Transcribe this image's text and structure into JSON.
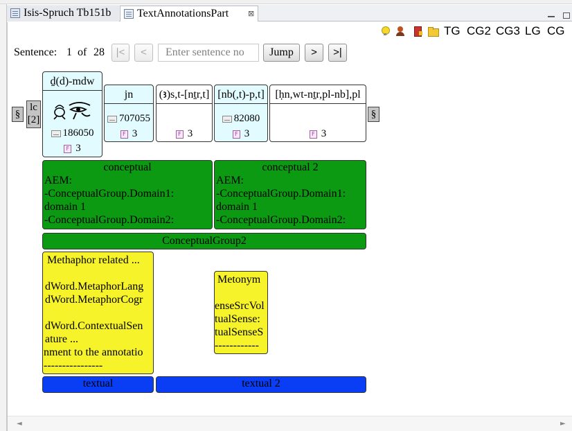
{
  "tabs": [
    {
      "label": "Isis-Spruch Tb151b",
      "icon": "document-icon",
      "active": false
    },
    {
      "label": "TextAnnotationsPart",
      "icon": "document-icon",
      "active": true,
      "close_glyph": "⊠"
    }
  ],
  "toolbar": {
    "icons": [
      "lightbulb-icon",
      "person-icon",
      "book-icon",
      "folder-icon"
    ],
    "links": [
      "TG",
      "CG2",
      "CG3",
      "LG",
      "CG"
    ]
  },
  "nav": {
    "label": "Sentence:",
    "current": "1",
    "of": "of",
    "total": "28",
    "first": "|<",
    "prev": "<",
    "input_placeholder": "Enter sentence no",
    "jump": "Jump",
    "next": ">",
    "last": ">|"
  },
  "sentence": {
    "section_mark": "§",
    "lc_label": "lc",
    "lc_index": "[2]",
    "words": [
      {
        "translit": "ḏ(d)-mdw",
        "has_glyphs": true,
        "lemma": "186050",
        "count": "3"
      },
      {
        "translit": "jn",
        "lemma": "707055",
        "count": "3"
      },
      {
        "translit": "(ꜣ)s,t-[nṯr,t]",
        "lemma": "",
        "count": "3"
      },
      {
        "translit": "[nb(,t)-p,t]",
        "lemma": "82080",
        "count": "3"
      },
      {
        "translit": "[ḥn,wt-nṯr,pl-nb],pl",
        "lemma": "",
        "count": "3"
      }
    ]
  },
  "conceptual": [
    {
      "title": "conceptual",
      "lines": [
        "AEM:",
        "-ConceptualGroup.Domain1:",
        "domain 1",
        "-ConceptualGroup.Domain2:"
      ]
    },
    {
      "title": "conceptual 2",
      "lines": [
        "AEM:",
        "-ConceptualGroup.Domain1:",
        "domain 1",
        "-ConceptualGroup.Domain2:"
      ]
    }
  ],
  "conceptual_group2": "ConceptualGroup2",
  "metaphor": {
    "title": "Methaphor related ...",
    "lines": [
      "dWord.MetaphorLang",
      "dWord.MetaphorCogr",
      "",
      "dWord.ContextualSen",
      "ature  ...",
      "nment to the annotatio",
      "----------------"
    ]
  },
  "metonym": {
    "title": "Metonym",
    "lines": [
      "enseSrcVol",
      "tualSense:",
      "tualSenseS",
      "------------"
    ]
  },
  "textual": [
    "textual",
    "textual 2"
  ],
  "colors": {
    "green": "#0c9a13",
    "yellow": "#f7f32a",
    "blue": "#0a3ef4",
    "cyan": "#e2fbfe",
    "grey": "#c4c4c4"
  },
  "scroll": {
    "left": "◄",
    "right": "►"
  }
}
